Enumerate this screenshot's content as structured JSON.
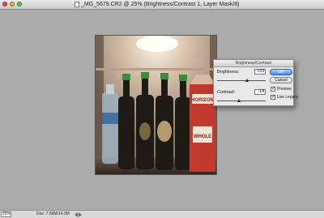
{
  "window": {
    "title": "_MG_5679.CR2 @ 25% (Brightness/Contrast 1, Layer Mask/8)"
  },
  "dialog": {
    "title": "Brightness/Contrast",
    "brightness_label": "Brightness:",
    "brightness_value": "+33",
    "brightness_level_pct": 63,
    "contrast_label": "Contrast:",
    "contrast_value": "-14",
    "contrast_level_pct": 45,
    "ok_label": "OK",
    "cancel_label": "Cancel",
    "preview_label": "Preview",
    "preview_checked": true,
    "legacy_label": "Use Legacy",
    "legacy_checked": true
  },
  "statusbar": {
    "zoom": "25%",
    "doc_info": "Doc: 7.69M/14.3M"
  },
  "photo": {
    "carton_brand": "HORIZON",
    "carton_text": "WHOLE"
  },
  "colors": {
    "ok_button": "#3d8ef0",
    "canvas": "#ababab"
  }
}
